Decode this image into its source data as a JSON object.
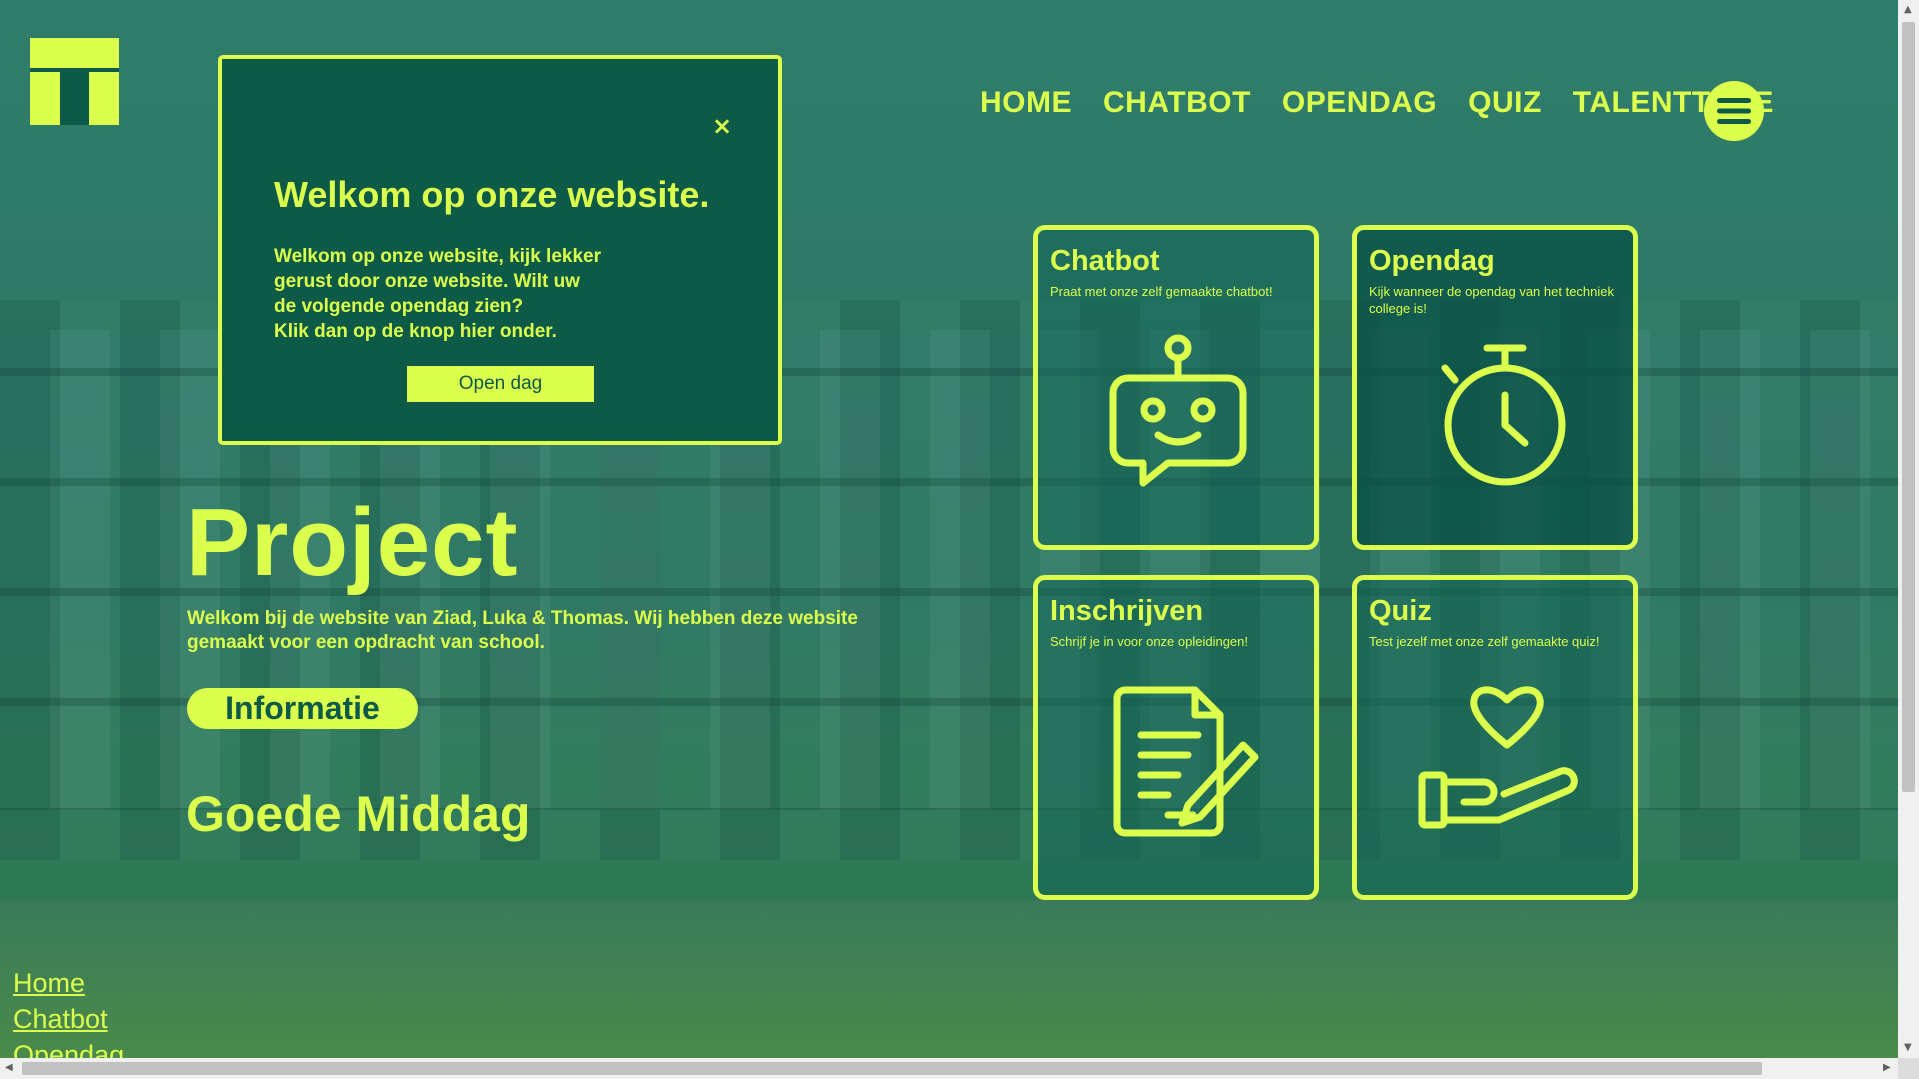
{
  "nav": {
    "items": [
      "HOME",
      "CHATBOT",
      "OPENDAG",
      "QUIZ",
      "TALENTTREE"
    ]
  },
  "popup": {
    "close": "×",
    "title": "Welkom op onze website.",
    "lines": [
      "Welkom op onze website, kijk lekker",
      "gerust door onze website. Wilt uw",
      "de volgende opendag zien?",
      "Klik dan op de knop hier onder."
    ],
    "button": "Open dag"
  },
  "hero": {
    "title": "Project",
    "text": "Welkom bij de website van Ziad, Luka & Thomas. Wij hebben deze website gemaakt voor een opdracht van school.",
    "button": "Informatie",
    "greeting": "Goede Middag"
  },
  "cards": [
    {
      "title": "Chatbot",
      "desc": "Praat met onze zelf gemaakte chatbot!",
      "icon": "robot-icon"
    },
    {
      "title": "Opendag",
      "desc": "Kijk wanneer de opendag van het techniek college is!",
      "icon": "stopwatch-icon"
    },
    {
      "title": "Inschrijven",
      "desc": "Schrijf je in voor onze opleidingen!",
      "icon": "document-pen-icon"
    },
    {
      "title": "Quiz",
      "desc": "Test jezelf met onze zelf gemaakte quiz!",
      "icon": "hand-heart-icon"
    }
  ],
  "footer": {
    "links": [
      "Home",
      "Chatbot",
      "Opendag"
    ]
  },
  "colors": {
    "accent": "#dcff4d",
    "dark_green": "#0d5a47",
    "overlay_green": "#2e7a66"
  }
}
